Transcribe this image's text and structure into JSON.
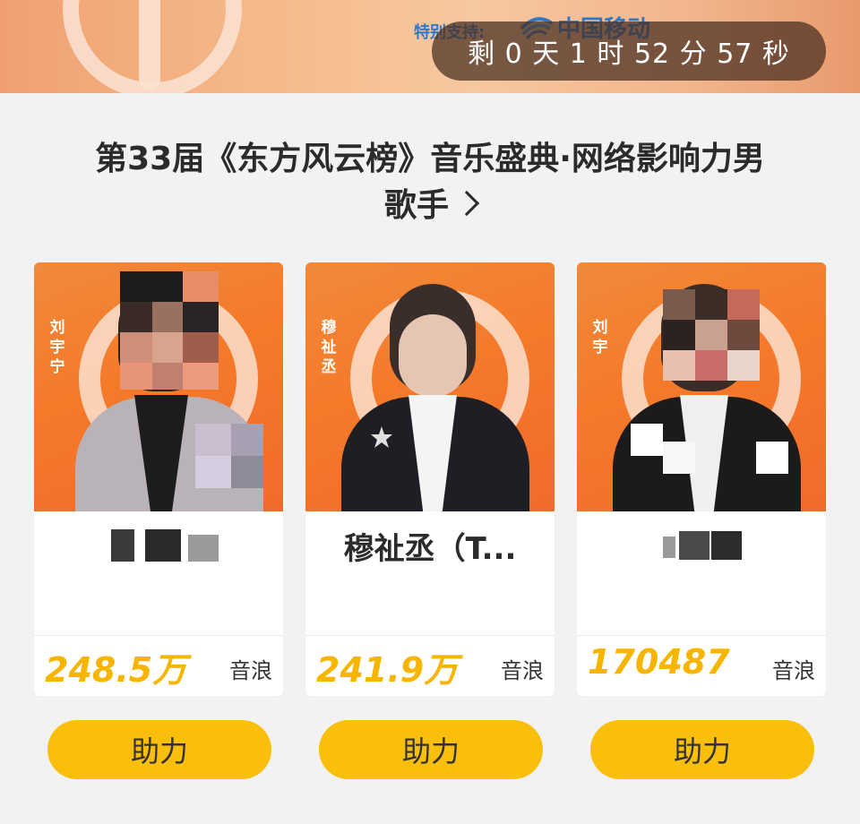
{
  "banner": {
    "sponsor_label": "特别支持:",
    "sponsor_name": "中国移动",
    "countdown": "剩 0 天 1 时 52 分 57 秒"
  },
  "title": {
    "line1": "第33届《东方风云榜》音乐盛典·网络影响力男",
    "line2": "歌手"
  },
  "candidates": [
    {
      "name": "",
      "side_label": "刘宇宁",
      "score": "248.5万",
      "unit": "音浪",
      "cheer_label": "助力"
    },
    {
      "name": "穆祉丞（T...",
      "side_label": "穆祉丞",
      "score": "241.9万",
      "unit": "音浪",
      "cheer_label": "助力"
    },
    {
      "name": "",
      "side_label": "刘宇",
      "score": "170487",
      "unit": "音浪",
      "cheer_label": "助力"
    }
  ],
  "colors": {
    "accent_yellow": "#f9bf0c",
    "score_yellow": "#f7b500",
    "photo_orange": "#f47a2a"
  }
}
